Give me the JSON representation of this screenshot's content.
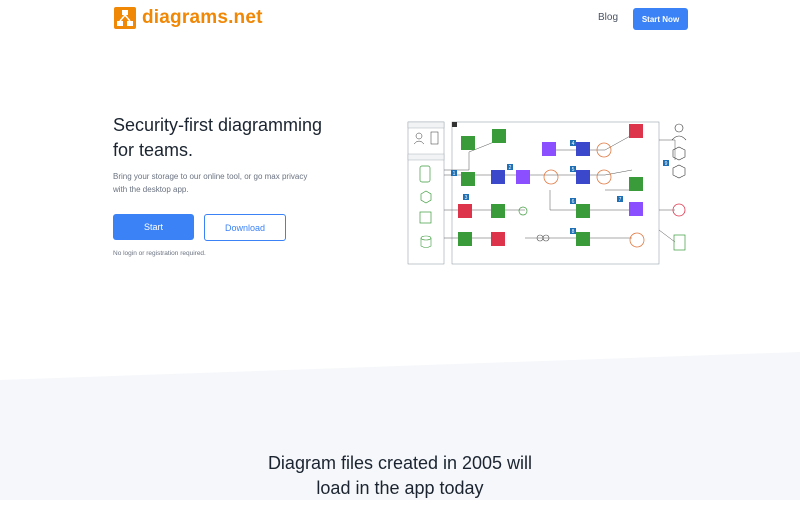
{
  "header": {
    "logo_text": "diagrams.net",
    "nav_blog": "Blog",
    "nav_start": "Start Now"
  },
  "hero": {
    "title_line1": "Security-first diagramming",
    "title_line2": "for teams.",
    "subtitle_line1": "Bring your storage to our online tool, or go max privacy",
    "subtitle_line2": "with the desktop app.",
    "start_label": "Start",
    "download_label": "Download",
    "note": "No login or registration required."
  },
  "section2": {
    "title_line1": "Diagram files created in 2005 will",
    "title_line2": "load in the app today"
  },
  "colors": {
    "accent": "#3b82f6",
    "brand": "#f08705",
    "band": "#f5f7fa"
  },
  "diagram_numbers": [
    "1",
    "2",
    "3",
    "4",
    "5",
    "6",
    "7",
    "8",
    "9"
  ]
}
